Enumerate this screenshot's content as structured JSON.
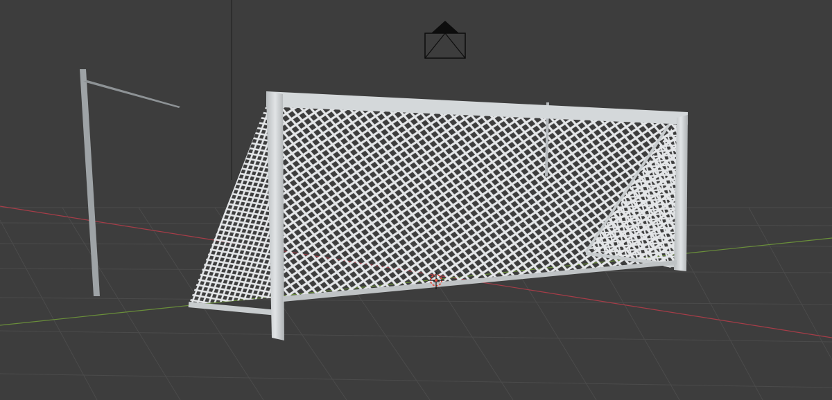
{
  "viewport": {
    "background": "#3d3d3d",
    "grid_line_color": "#4a4a4a",
    "x_axis_color": "#b4424f",
    "y_axis_color": "#6e9b3a",
    "frame_color": "#d2d6d8",
    "net_color": "#e4e6e8",
    "camera_color": "#0d0d0d",
    "origin_color": "#e24a3e"
  },
  "objects": [
    "camera",
    "goal-frame",
    "goal-net",
    "lamp-post",
    "3d-cursor"
  ]
}
